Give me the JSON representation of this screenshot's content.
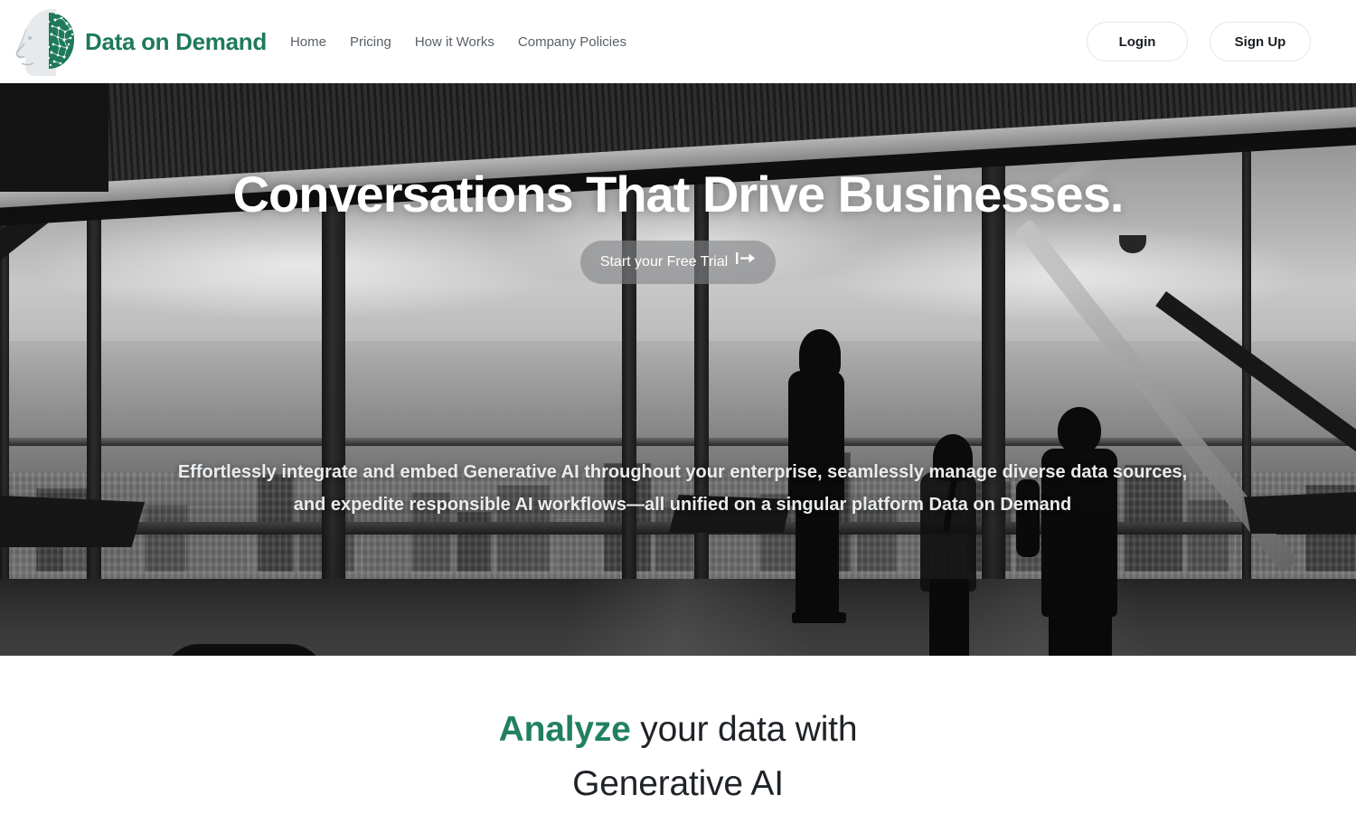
{
  "brand": {
    "name": "Data on Demand",
    "logo_icon": "face-brain-logo-icon",
    "accent_color": "#1e7a5a"
  },
  "nav": {
    "items": [
      {
        "label": "Home"
      },
      {
        "label": "Pricing"
      },
      {
        "label": "How it Works"
      },
      {
        "label": "Company Policies"
      }
    ]
  },
  "header_actions": {
    "login_label": "Login",
    "signup_label": "Sign Up"
  },
  "hero": {
    "title": "Conversations That Drive Businesses.",
    "cta_label": "Start your Free Trial",
    "cta_icon": "bar-arrow-right-icon",
    "cta_glyph": "⇥",
    "subtitle": "Effortlessly integrate and embed Generative AI throughout your enterprise, seamlessly manage diverse data sources, and expedite responsible AI workflows—all unified on a singular platform Data on Demand",
    "image_description": "Grayscale photo of three business people in silhouette standing by floor-to-ceiling office windows overlooking a city skyline"
  },
  "analyze_section": {
    "accent_word": "Analyze",
    "rest_line1": " your data with",
    "line2": "Generative AI",
    "accent_color": "#21815f"
  }
}
